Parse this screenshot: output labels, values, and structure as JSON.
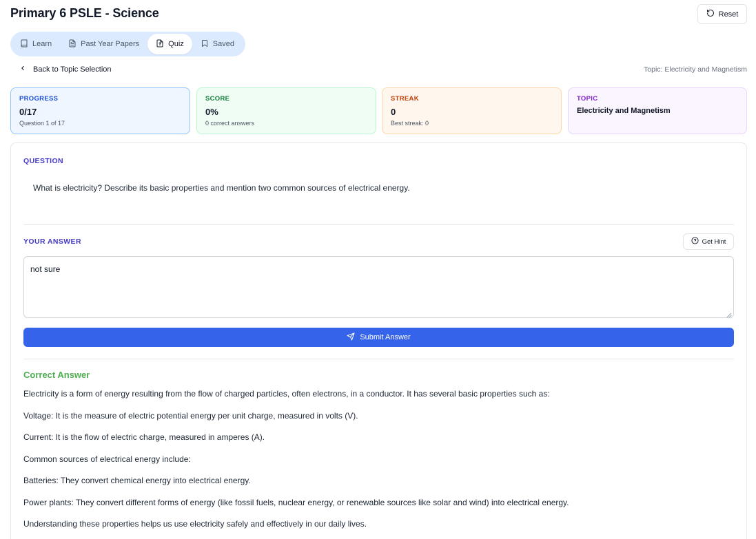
{
  "page": {
    "title": "Primary 6 PSLE - Science"
  },
  "header": {
    "reset_label": "Reset"
  },
  "tabs": [
    {
      "label": "Learn",
      "icon": "book-icon",
      "active": false
    },
    {
      "label": "Past Year Papers",
      "icon": "document-icon",
      "active": false
    },
    {
      "label": "Quiz",
      "icon": "quiz-icon",
      "active": true
    },
    {
      "label": "Saved",
      "icon": "bookmark-icon",
      "active": false
    }
  ],
  "nav": {
    "back_label": "Back to Topic Selection",
    "topic_meta": "Topic: Electricity and Magnetism"
  },
  "stats": {
    "progress": {
      "label": "PROGRESS",
      "value": "0/17",
      "sub": "Question 1 of 17"
    },
    "score": {
      "label": "SCORE",
      "value": "0%",
      "sub": "0 correct answers"
    },
    "streak": {
      "label": "STREAK",
      "value": "0",
      "sub": "Best streak: 0"
    },
    "topic": {
      "label": "TOPIC",
      "value": "Electricity and Magnetism"
    }
  },
  "question": {
    "label": "QUESTION",
    "text": "What is electricity? Describe its basic properties and mention two common sources of electrical energy."
  },
  "answer": {
    "label": "YOUR ANSWER",
    "hint_label": "Get Hint",
    "value": "not sure",
    "submit_label": "Submit Answer"
  },
  "correct_answer": {
    "title": "Correct Answer",
    "lines": [
      "Electricity is a form of energy resulting from the flow of charged particles, often electrons, in a conductor. It has several basic properties such as:",
      "Voltage: It is the measure of electric potential energy per unit charge, measured in volts (V).",
      "Current: It is the flow of electric charge, measured in amperes (A).",
      "Common sources of electrical energy include:",
      "Batteries: They convert chemical energy into electrical energy.",
      "Power plants: They convert different forms of energy (like fossil fuels, nuclear energy, or renewable sources like solar and wind) into electrical energy.",
      "Understanding these properties helps us use electricity safely and effectively in our daily lives."
    ]
  },
  "colors": {
    "primary": "#3563e9",
    "tabs_bg": "#dbeafe",
    "correct": "#4caf50",
    "section_label": "#4338ca"
  }
}
